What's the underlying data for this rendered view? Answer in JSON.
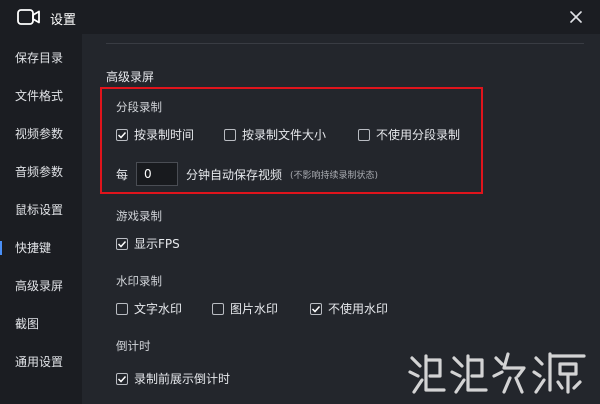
{
  "window": {
    "title": "设置"
  },
  "sidebar": {
    "items": [
      {
        "label": "保存目录"
      },
      {
        "label": "文件格式"
      },
      {
        "label": "视频参数"
      },
      {
        "label": "音频参数"
      },
      {
        "label": "鼠标设置"
      },
      {
        "label": "快捷键"
      },
      {
        "label": "高级录屏"
      },
      {
        "label": "截图"
      },
      {
        "label": "通用设置"
      }
    ],
    "active_index": 5
  },
  "main": {
    "heading": "高级录屏",
    "segment": {
      "title": "分段录制",
      "options": [
        {
          "label": "按录制时间",
          "checked": true
        },
        {
          "label": "按录制文件大小",
          "checked": false
        },
        {
          "label": "不使用分段录制",
          "checked": false
        }
      ],
      "interval": {
        "prefix": "每",
        "value": "0",
        "suffix": "分钟自动保存视频",
        "hint": "(不影响持续录制状态)"
      }
    },
    "game": {
      "title": "游戏录制",
      "options": [
        {
          "label": "显示FPS",
          "checked": true
        }
      ]
    },
    "watermark": {
      "title": "水印录制",
      "options": [
        {
          "label": "文字水印",
          "checked": false
        },
        {
          "label": "图片水印",
          "checked": false
        },
        {
          "label": "不使用水印",
          "checked": true
        }
      ]
    },
    "countdown": {
      "title": "倒计时",
      "options": [
        {
          "label": "录制前展示倒计时",
          "checked": true
        }
      ]
    }
  },
  "colors": {
    "background": "#23262c",
    "sidebar": "#1b1d22",
    "highlight": "#e0141c",
    "accent": "#4a8ff7"
  },
  "icons": {
    "app": "video-camera-icon",
    "close": "close-icon",
    "check": "checkmark-icon"
  }
}
